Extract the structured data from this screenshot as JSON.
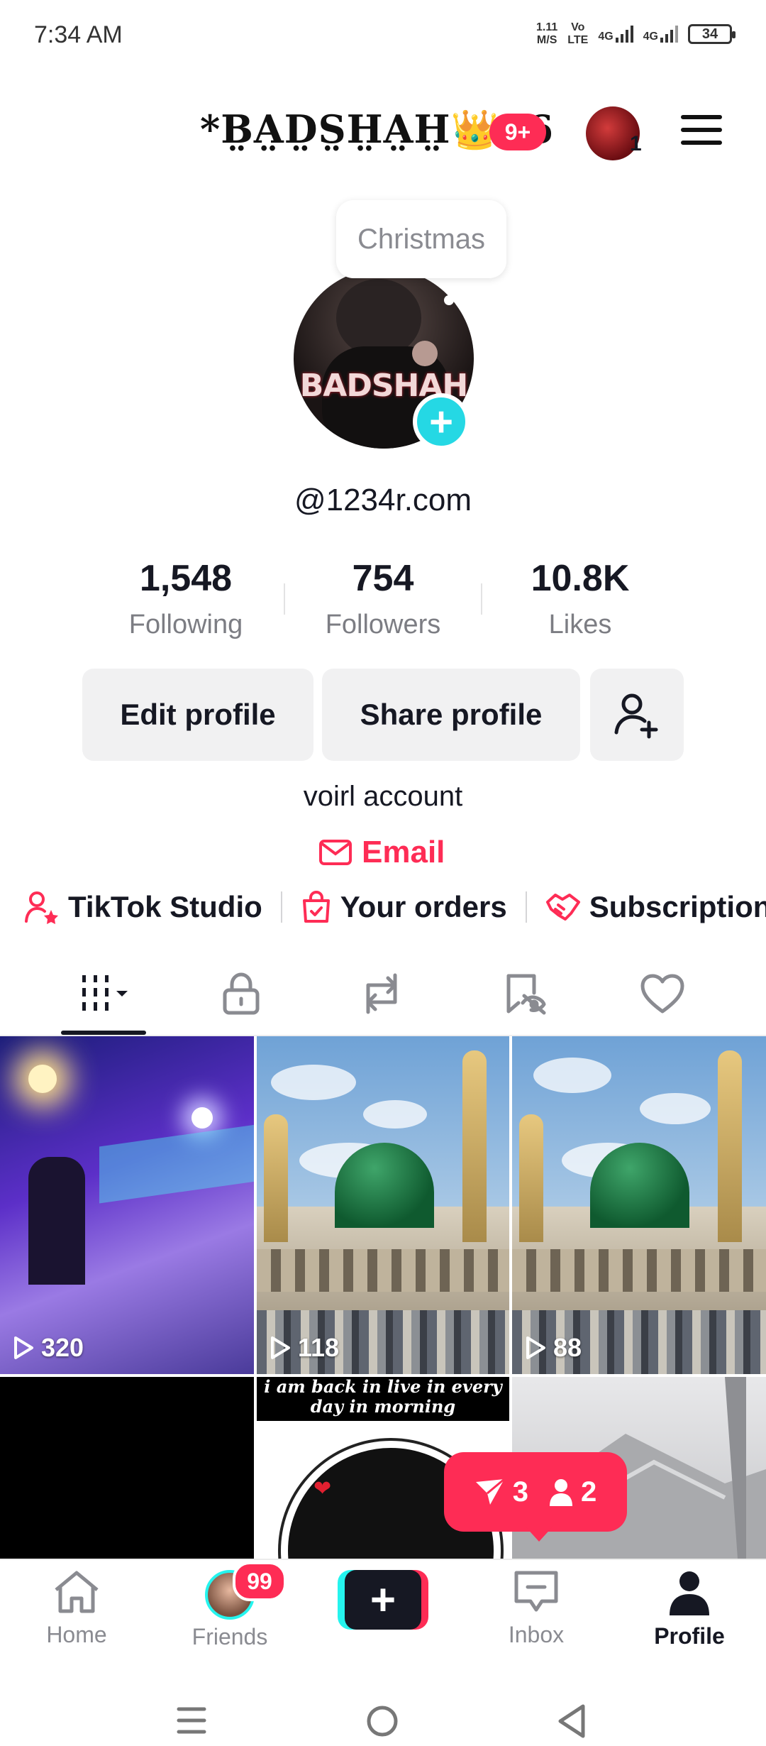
{
  "status_bar": {
    "time": "7:34 AM",
    "speed_top": "1.11",
    "speed_bottom": "M/S",
    "volte_top": "Vo",
    "volte_bottom": "LTE",
    "net1": "4G",
    "net2": "4G",
    "battery": "34"
  },
  "header": {
    "username": "*B̤A̤D̤S̤H̤A̤H̤👑46",
    "notification_badge": "9+",
    "account_count": "1"
  },
  "profile": {
    "note_bubble": "Christmas",
    "avatar_text": "BADSHAH",
    "handle": "@1234r.com",
    "stats": [
      {
        "value": "1,548",
        "label": "Following"
      },
      {
        "value": "754",
        "label": "Followers"
      },
      {
        "value": "10.8K",
        "label": "Likes"
      }
    ],
    "edit_button": "Edit profile",
    "share_button": "Share profile",
    "bio": "voirl account",
    "email_label": "Email",
    "links": [
      {
        "label": "TikTok Studio",
        "icon": "person-star-icon"
      },
      {
        "label": "Your orders",
        "icon": "shopping-bag-icon"
      },
      {
        "label": "Subscription",
        "icon": "handshake-icon"
      }
    ]
  },
  "tabs": [
    "videos-grid-icon",
    "lock-icon",
    "repost-icon",
    "hidden-bookmark-icon",
    "heart-icon"
  ],
  "videos": [
    {
      "views": "320"
    },
    {
      "views": "118"
    },
    {
      "views": "88"
    }
  ],
  "video_overlay_text": "i am back in live in every day in morning",
  "notification_pill": {
    "messages": "3",
    "people": "2"
  },
  "nav": {
    "home": "Home",
    "friends": "Friends",
    "friends_badge": "99",
    "inbox": "Inbox",
    "profile": "Profile"
  },
  "colors": {
    "accent": "#fe2c55",
    "cyan": "#25f4ee",
    "text": "#161823"
  }
}
